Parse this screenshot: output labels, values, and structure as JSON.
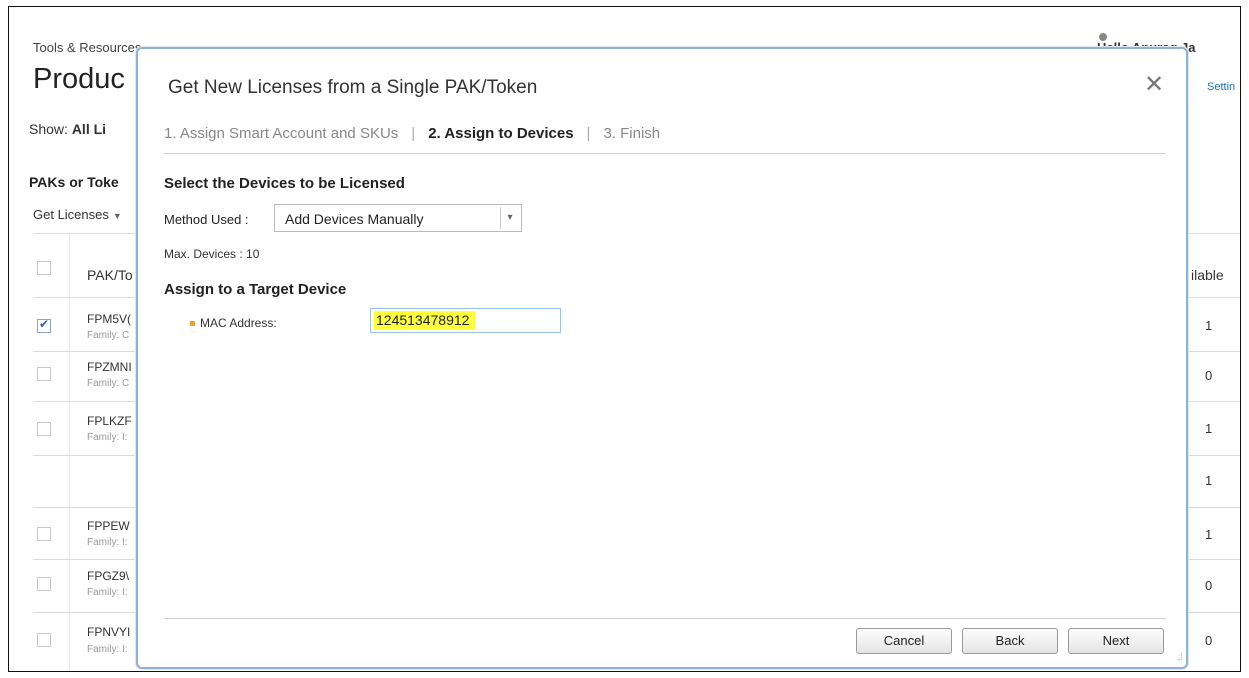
{
  "background": {
    "breadcrumb": "Tools & Resources",
    "greeting": "Hello Anurag Ja",
    "page_title": "Produc",
    "settings_link": "Settin",
    "show_label": "Show:",
    "show_value": "All Li",
    "paks_title": "PAKs or Toke",
    "get_licenses": "Get Licenses",
    "col_pak": "PAK/To",
    "col_available": "ilable",
    "rows": [
      {
        "code": "FPM5V(",
        "family": "Family: C",
        "available": "1",
        "checked": true
      },
      {
        "code": "FPZMNI",
        "family": "Family: C",
        "available": "0",
        "checked": false
      },
      {
        "code": "FPLKZF",
        "family": "Family: I:",
        "available": "1",
        "checked": false
      },
      {
        "code": "",
        "family": "",
        "available": "1",
        "checked": false
      },
      {
        "code": "FPPEW",
        "family": "Family: I:",
        "available": "1",
        "checked": false
      },
      {
        "code": "FPGZ9\\",
        "family": "Family: I:",
        "available": "0",
        "checked": false
      },
      {
        "code": "FPNVYI",
        "family": "Family: I:",
        "available": "0",
        "checked": false
      }
    ]
  },
  "modal": {
    "title": "Get New Licenses from a Single PAK/Token",
    "steps": [
      {
        "label": "1. Assign Smart Account and SKUs",
        "active": false
      },
      {
        "label": "2. Assign to Devices",
        "active": true
      },
      {
        "label": "3. Finish",
        "active": false
      }
    ],
    "section_select": "Select the Devices to be Licensed",
    "method_label": "Method Used :",
    "method_value": "Add Devices Manually",
    "max_devices": "Max. Devices : 10",
    "section_target": "Assign to a Target Device",
    "mac_label": "MAC Address:",
    "mac_value": "124513478912",
    "buttons": {
      "cancel": "Cancel",
      "back": "Back",
      "next": "Next"
    }
  },
  "colors": {
    "highlight": "#ffff3a",
    "modal_border": "#8fb3d6",
    "required_marker": "#f0a030"
  }
}
